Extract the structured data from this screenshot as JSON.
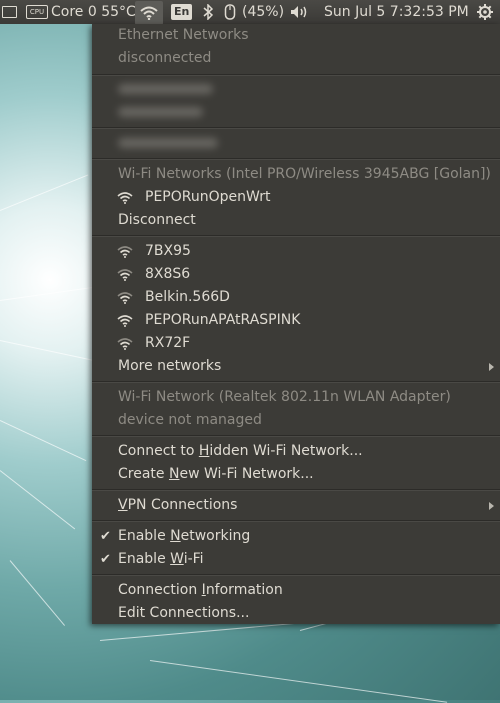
{
  "panel": {
    "cpu_chip": "CPU",
    "cpu_temp": "Core 0 55°C",
    "keyboard": "En",
    "battery": "(45%)",
    "clock": "Sun Jul  5  7:32:53 PM",
    "icons": [
      "window-icon",
      "cpu-icon",
      "wifi-icon",
      "bluetooth-icon",
      "mouse-battery-icon",
      "volume-icon",
      "gear-icon"
    ]
  },
  "menu": {
    "ethernet_header": "Ethernet Networks",
    "ethernet_status": "disconnected",
    "wifi_header": "Wi-Fi Networks (Intel PRO/Wireless 3945ABG [Golan])",
    "connected_network": "PEPORunOpenWrt",
    "disconnect": "Disconnect",
    "networks": [
      "7BX95",
      "8X8S6",
      "Belkin.566D",
      "PEPORunAPAtRASPINK",
      "RX72F"
    ],
    "more_networks": "More networks",
    "wifi2_header": "Wi-Fi Network (Realtek 802.11n WLAN Adapter)",
    "wifi2_status": "device not managed",
    "hidden_pre": "Connect to ",
    "hidden_u": "H",
    "hidden_post": "idden Wi-Fi Network...",
    "create_pre": "Create ",
    "create_u": "N",
    "create_post": "ew Wi-Fi Network...",
    "vpn_u": "V",
    "vpn_post": "PN Connections",
    "networking_pre": "Enable ",
    "networking_u": "N",
    "networking_post": "etworking",
    "wifi_en_pre": "Enable ",
    "wifi_en_u": "W",
    "wifi_en_post": "i-Fi",
    "conninfo_pre": "Connection ",
    "conninfo_u": "I",
    "conninfo_post": "nformation",
    "edit_connections": "Edit Connections..."
  }
}
